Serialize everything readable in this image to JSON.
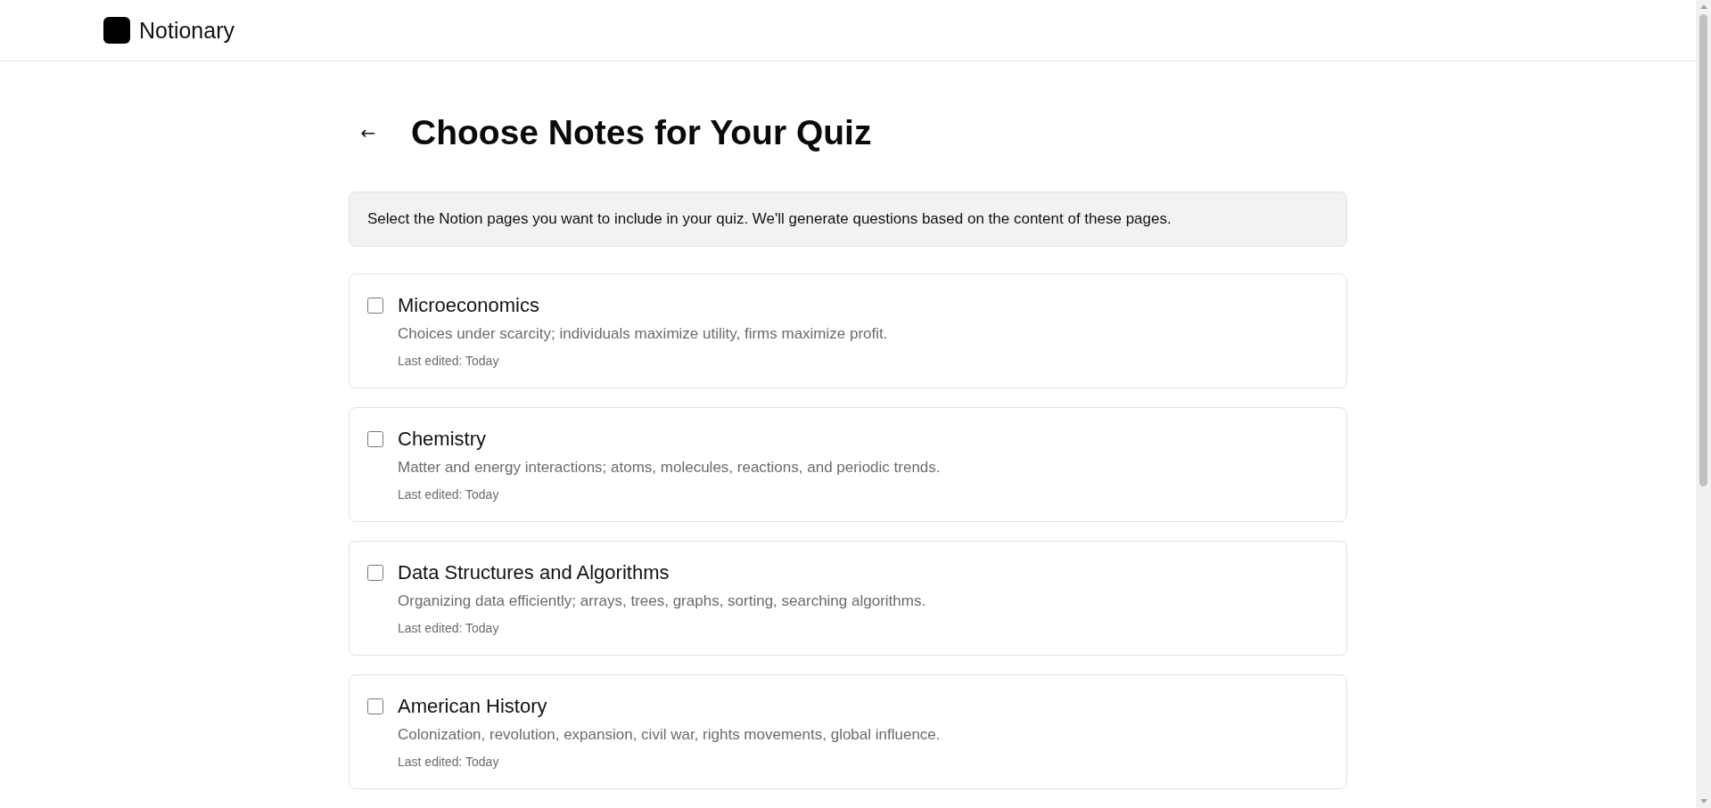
{
  "header": {
    "brand": "Notionary"
  },
  "page": {
    "back_icon": "←",
    "title": "Choose Notes for Your Quiz"
  },
  "info": "Select the Notion pages you want to include in your quiz. We'll generate questions based on the content of these pages.",
  "notes": [
    {
      "title": "Microeconomics",
      "description": "Choices under scarcity; individuals maximize utility, firms maximize profit.",
      "edited": "Last edited: Today",
      "checked": false
    },
    {
      "title": "Chemistry",
      "description": "Matter and energy interactions; atoms, molecules, reactions, and periodic trends.",
      "edited": "Last edited: Today",
      "checked": false
    },
    {
      "title": "Data Structures and Algorithms",
      "description": "Organizing data efficiently; arrays, trees, graphs, sorting, searching algorithms.",
      "edited": "Last edited: Today",
      "checked": false
    },
    {
      "title": "American History",
      "description": "Colonization, revolution, expansion, civil war, rights movements, global influence.",
      "edited": "Last edited: Today",
      "checked": false
    }
  ]
}
